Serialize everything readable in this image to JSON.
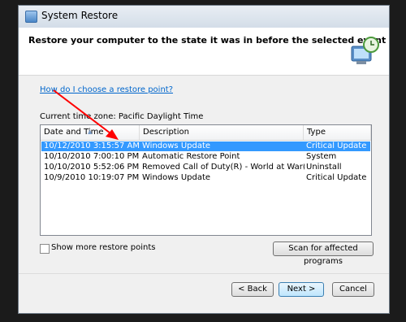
{
  "window": {
    "title": "System Restore"
  },
  "header": {
    "text": "Restore your computer to the state it was in before the selected event"
  },
  "help_link": "How do I choose a restore point?",
  "timezone": "Current time zone: Pacific Daylight Time",
  "table": {
    "columns": [
      "Date and Time",
      "Description",
      "Type"
    ],
    "rows": [
      [
        "10/12/2010 3:15:57 AM",
        "Windows Update",
        "Critical Update"
      ],
      [
        "10/10/2010 7:00:10 PM",
        "Automatic Restore Point",
        "System"
      ],
      [
        "10/10/2010 5:52:06 PM",
        "Removed Call of Duty(R) - World at War(TM)",
        "Uninstall"
      ],
      [
        "10/9/2010 10:19:07 PM",
        "Windows Update",
        "Critical Update"
      ]
    ],
    "selected_row": 0
  },
  "show_more": {
    "label": "Show more restore points",
    "checked": false
  },
  "buttons": {
    "scan": "Scan for affected programs",
    "back": "< Back",
    "next": "Next >",
    "cancel": "Cancel"
  },
  "colors": {
    "selection": "#3399ff",
    "link": "#0066cc",
    "annotation_arrow": "#ff0000"
  },
  "icons": {
    "title_icon": "system-restore-icon",
    "header_icon": "restore-computer-clock-icon"
  }
}
